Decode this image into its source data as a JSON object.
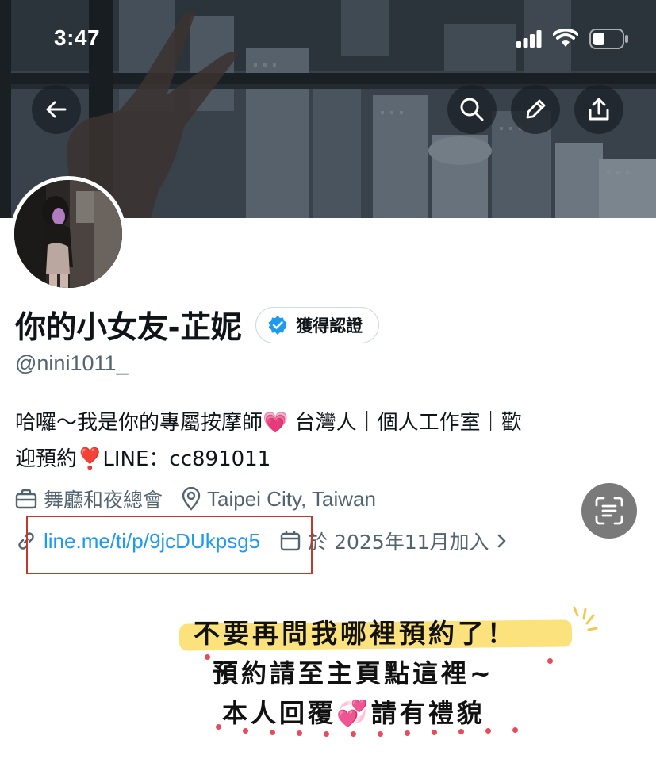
{
  "status_bar": {
    "time": "3:47"
  },
  "header": {
    "back_icon": "arrow-left-icon",
    "search_icon": "search-icon",
    "edit_icon": "pencil-icon",
    "share_icon": "share-upload-icon"
  },
  "profile": {
    "display_name": "你的小女友-芷妮",
    "verified_label": "獲得認證",
    "handle": "@nini1011_",
    "bio_line1": "哈囉～我是你的專屬按摩師💗 台灣人｜個人工作室｜歡",
    "bio_line2": "迎預約❣️LINE：cc891011",
    "category": "舞廳和夜總會",
    "location": "Taipei City, Taiwan",
    "link": "line.me/ti/p/9jcDUkpsg5",
    "joined": "於 2025年11月加入"
  },
  "annotation": {
    "line1": "不要再問我哪裡預約了！",
    "line2": "預約請至主頁點這裡~",
    "line3_part1": "本人回覆",
    "line3_emoji": "💞",
    "line3_part2": "請有禮貌"
  },
  "colors": {
    "text_primary": "#0f1419",
    "text_secondary": "#536471",
    "link": "#1d9bf0",
    "verified": "#1d9bf0",
    "highlight_box": "#c0392b",
    "marker": "#fbe27d"
  }
}
